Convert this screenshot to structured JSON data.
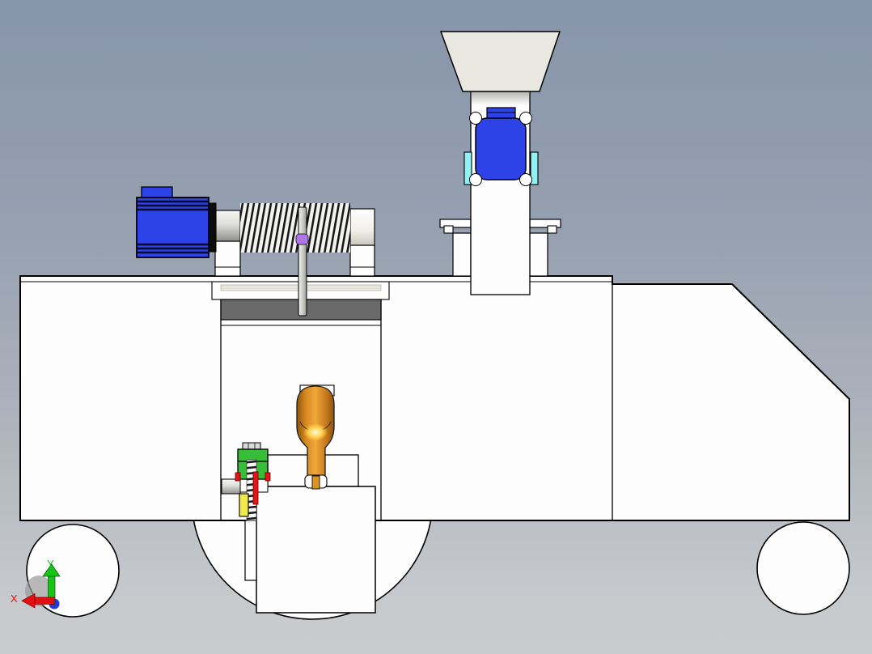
{
  "viewport": {
    "type": "3d-cad-model-view",
    "description": "Side view of a wheeled pellet-mill style machine: hopper funnel feeding a duct with a blue motor, a horizontal screw-spring conveyor driven by a blue gear motor, an orange auger cylinder and a green spring-loaded clamp inside the chassis, three white wheels"
  },
  "triad": {
    "x_label": "X",
    "y_label": "Y"
  },
  "colors": {
    "bg_top": "#8795ab",
    "bg_bottom": "#c7cacd",
    "body": "#fdfdfd",
    "outline": "#000000",
    "funnel": "#e9e8e0",
    "blue": "#2d43e8",
    "blue_dark": "#070b2a",
    "cyan": "#8ff2f4",
    "dark_bar": "#696969",
    "stripe": "#e6e6dc",
    "orange": "#e0921f",
    "orange_highlight": "#ffe98a",
    "green": "#38bd38",
    "yellow": "#f2ea49",
    "red": "#e81414",
    "purple": "#ae77e8",
    "axis_x": "#e21010",
    "axis_y": "#16c316",
    "axis_z_dot": "#2336dd"
  },
  "parts": [
    {
      "name": "hopper-funnel",
      "color": "funnel"
    },
    {
      "name": "feed-duct",
      "color": "body"
    },
    {
      "name": "feeder-motor",
      "color": "blue"
    },
    {
      "name": "feeder-motor-side-tab",
      "color": "cyan"
    },
    {
      "name": "drive-motor",
      "color": "blue"
    },
    {
      "name": "motor-coupling",
      "color": "outline"
    },
    {
      "name": "screw-conveyor-spring",
      "color": "body"
    },
    {
      "name": "pusher-rod",
      "color": "body"
    },
    {
      "name": "rod-collar",
      "color": "purple"
    },
    {
      "name": "chassis-body",
      "color": "body"
    },
    {
      "name": "mixing-chamber-bar",
      "color": "dark_bar"
    },
    {
      "name": "auger-cylinder",
      "color": "orange"
    },
    {
      "name": "clamp-block",
      "color": "green"
    },
    {
      "name": "clamp-spring",
      "color": "body"
    },
    {
      "name": "clamp-slider",
      "color": "yellow"
    },
    {
      "name": "clamp-pin",
      "color": "red"
    },
    {
      "name": "front-wheel",
      "color": "body"
    },
    {
      "name": "center-wheel",
      "color": "body"
    },
    {
      "name": "rear-wheel",
      "color": "body"
    },
    {
      "name": "origin-triad",
      "color": "axis_x"
    }
  ]
}
